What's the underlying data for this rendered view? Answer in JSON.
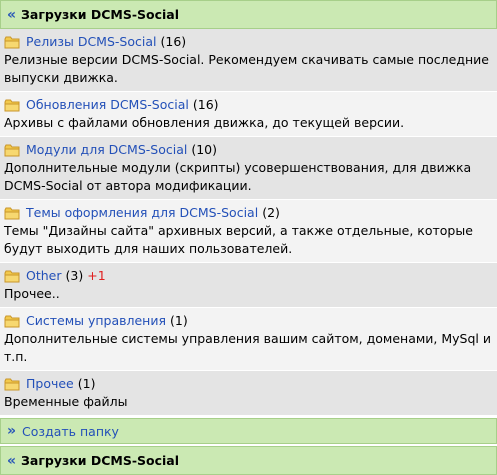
{
  "header": {
    "arrow": "«",
    "title": "Загрузки DCMS-Social"
  },
  "folders": [
    {
      "name": "Релизы DCMS-Social",
      "count": "(16)",
      "badge": "",
      "desc": "Релизные версии DCMS-Social. Рекомендуем скачивать самые последние выпуски движка."
    },
    {
      "name": "Обновления DCMS-Social",
      "count": "(16)",
      "badge": "",
      "desc": "Архивы с файлами обновления движка, до текущей версии."
    },
    {
      "name": "Модули для DCMS-Social",
      "count": "(10)",
      "badge": "",
      "desc": "Дополнительные модули (скрипты) усовершенствования, для движка DCMS-Social от автора модификации."
    },
    {
      "name": "Темы оформления для DCMS-Social",
      "count": "(2)",
      "badge": "",
      "desc": "Темы \"Дизайны сайта\" архивных версий, а также отдельные, которые будут выходить для наших пользователей."
    },
    {
      "name": "Other",
      "count": "(3)",
      "badge": "+1",
      "desc": "Прочее.."
    },
    {
      "name": "Системы управления",
      "count": "(1)",
      "badge": "",
      "desc": "Дополнительные системы управления вашим сайтом, доменами, MySql и т.п."
    },
    {
      "name": "Прочее",
      "count": "(1)",
      "badge": "",
      "desc": "Временные файлы"
    }
  ],
  "actions": {
    "arrow": "»",
    "create_folder": "Создать папку"
  },
  "footer": {
    "arrow": "«",
    "title": "Загрузки DCMS-Social"
  },
  "icons": {
    "folder": "folder-icon",
    "back": "back-arrow-icon",
    "forward": "forward-arrow-icon"
  },
  "colors": {
    "bar_bg": "#cbe9b3",
    "link": "#2350b8",
    "badge": "#e02020",
    "row_odd": "#e4e4e4",
    "row_even": "#f3f3f3"
  }
}
